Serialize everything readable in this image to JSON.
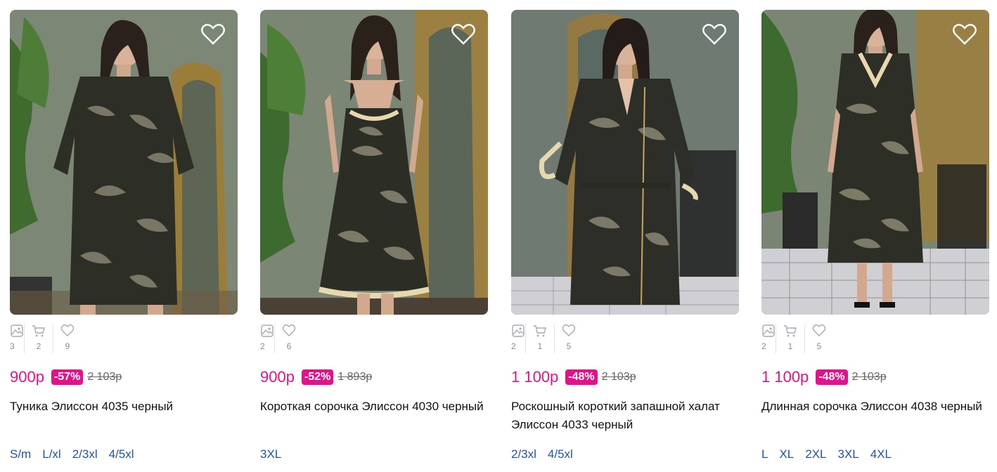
{
  "colors": {
    "accent_pink": "#e0138c",
    "size_link": "#1d56a8",
    "stat_gray": "#8a8a95"
  },
  "products": [
    {
      "title": "Туника Элиссон 4035 черный",
      "price": "900р",
      "discount": "-57%",
      "old_price": "2 103р",
      "stats": {
        "photos": "3",
        "cart": "2",
        "likes": "9"
      },
      "has_cart_stat": true,
      "sizes": [
        "S/m",
        "L/xl",
        "2/3xl",
        "4/5xl"
      ]
    },
    {
      "title": "Короткая сорочка Элиссон 4030 черный",
      "price": "900р",
      "discount": "-52%",
      "old_price": "1 893р",
      "stats": {
        "photos": "2",
        "likes": "6"
      },
      "has_cart_stat": false,
      "sizes": [
        "3XL"
      ]
    },
    {
      "title": "Роскошный короткий запашной халат Элиссон 4033 черный",
      "price": "1 100р",
      "discount": "-48%",
      "old_price": "2 103р",
      "stats": {
        "photos": "2",
        "cart": "1",
        "likes": "5"
      },
      "has_cart_stat": true,
      "sizes": [
        "2/3xl",
        "4/5xl"
      ]
    },
    {
      "title": "Длинная сорочка Элиссон 4038 черный",
      "price": "1 100р",
      "discount": "-48%",
      "old_price": "2 103р",
      "stats": {
        "photos": "2",
        "cart": "1",
        "likes": "5"
      },
      "has_cart_stat": true,
      "sizes": [
        "L",
        "XL",
        "2XL",
        "3XL",
        "4XL"
      ]
    }
  ],
  "icons": {
    "favorite": "heart-icon",
    "photos": "image-icon",
    "cart": "cart-icon",
    "likes": "heart-outline-icon"
  }
}
